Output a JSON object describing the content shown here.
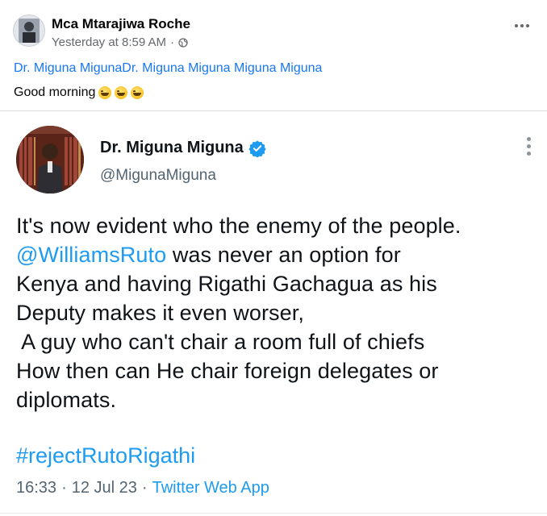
{
  "post": {
    "author": "Mca Mtarajiwa Roche",
    "timestamp": "Yesterday at 8:59 AM",
    "separator": "·",
    "audience_icon": "globe-icon",
    "menu_icon": "more-horizontal-icon",
    "mentions": "Dr. Miguna MigunaDr. Miguna Miguna Miguna Miguna",
    "caption": "Good morning",
    "caption_emojis": [
      "grinning-face",
      "grinning-face",
      "grinning-face"
    ]
  },
  "tweet": {
    "name": "Dr. Miguna Miguna",
    "verified_icon": "verified-badge-icon",
    "handle": "@MigunaMiguna",
    "menu_icon": "more-vertical-icon",
    "lines": {
      "l1": "It's now evident who the enemy of the people.",
      "l2_link": "@WilliamsRuto",
      "l2_rest": " was never an option for",
      "l3": "Kenya and having Rigathi Gachagua as his",
      "l4": "Deputy makes it even worser,",
      "l5": " A guy who can't chair a room full of chiefs",
      "l6": "How then can He chair foreign delegates or",
      "l7": "diplomats."
    },
    "hashtag": "#rejectRutoRigathi",
    "time": "16:33",
    "dot1": "·",
    "date": "12 Jul 23",
    "dot2": "·",
    "source": "Twitter Web App"
  },
  "colors": {
    "fb_link": "#1877f2",
    "twitter_blue": "#1d9bf0",
    "meta_gray": "#65676b",
    "tweet_gray": "#536471"
  }
}
